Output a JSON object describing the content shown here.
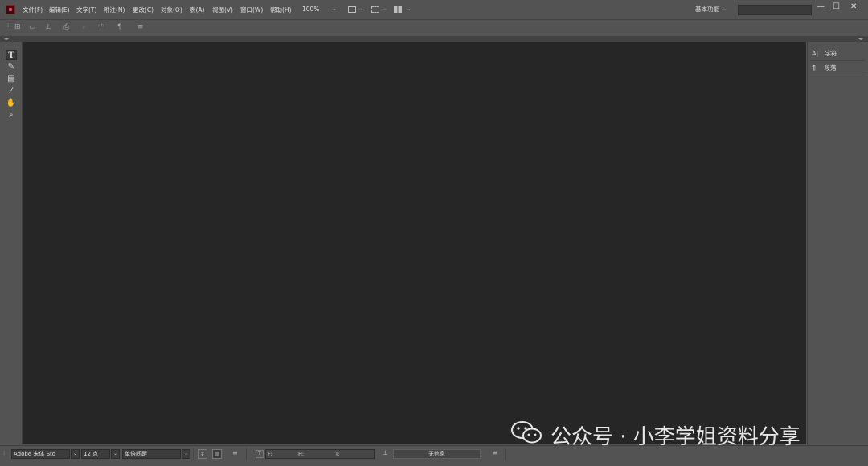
{
  "menubar": {
    "items": [
      "文件(F)",
      "编辑(E)",
      "文字(T)",
      "附注(N)",
      "更改(C)",
      "对象(O)",
      "表(A)",
      "视图(V)",
      "窗口(W)",
      "帮助(H)"
    ],
    "zoom": "100%",
    "workspace": "基本功能",
    "window_controls": [
      "—",
      "☐",
      "✕"
    ]
  },
  "tools": [
    "text-tool",
    "note-tool",
    "story-tool",
    "eyedropper-tool",
    "hand-tool",
    "zoom-tool"
  ],
  "right_panel": {
    "items": [
      {
        "icon": "A|",
        "label": "字符"
      },
      {
        "icon": "¶",
        "label": "段落"
      }
    ]
  },
  "bottombar": {
    "font": "Adobe 宋体 Std",
    "size": "12 点",
    "spacing": "单倍间距",
    "metric_labels": [
      "F:",
      "H:",
      "T:"
    ],
    "info": "无信息"
  },
  "watermark": {
    "text": "公众号 · 小李学姐资料分享"
  }
}
